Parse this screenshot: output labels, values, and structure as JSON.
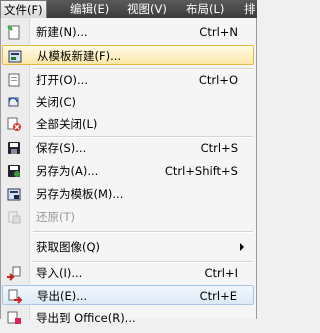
{
  "menubar": {
    "items": [
      "文件(F)",
      "编辑(E)",
      "视图(V)",
      "布局(L)",
      "排"
    ]
  },
  "menu": {
    "items": [
      {
        "label": "新建(N)...",
        "shortcut": "Ctrl+N",
        "icon": "new-document-icon"
      },
      {
        "label": "从模板新建(F)...",
        "shortcut": "",
        "icon": "new-from-template-icon"
      },
      {
        "label": "打开(O)...",
        "shortcut": "Ctrl+O",
        "icon": "open-folder-icon"
      },
      {
        "label": "关闭(C)",
        "shortcut": "",
        "icon": "close-document-icon"
      },
      {
        "label": "全部关闭(L)",
        "shortcut": "",
        "icon": "close-all-icon"
      },
      {
        "label": "保存(S)...",
        "shortcut": "Ctrl+S",
        "icon": "save-icon"
      },
      {
        "label": "另存为(A)...",
        "shortcut": "Ctrl+Shift+S",
        "icon": "save-as-icon"
      },
      {
        "label": "另存为模板(M)...",
        "shortcut": "",
        "icon": "save-as-template-icon"
      },
      {
        "label": "还原(T)",
        "shortcut": "",
        "icon": "revert-icon"
      },
      {
        "label": "获取图像(Q)",
        "shortcut": "",
        "icon": ""
      },
      {
        "label": "导入(I)...",
        "shortcut": "Ctrl+I",
        "icon": "import-icon"
      },
      {
        "label": "导出(E)...",
        "shortcut": "Ctrl+E",
        "icon": "export-icon"
      },
      {
        "label": "导出到 Office(R)...",
        "shortcut": "",
        "icon": "export-office-icon"
      }
    ]
  },
  "colors": {
    "menubar_bg": "#444444",
    "highlight_yellow": "#fde9a8",
    "highlight_blue": "#dceaf7"
  }
}
